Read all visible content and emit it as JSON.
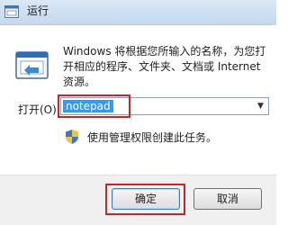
{
  "window": {
    "title": "运行",
    "icon": "run-icon"
  },
  "main": {
    "description": "Windows 将根据您所输入的名称，为您打开相应的程序、文件夹、文档或 Internet 资源。",
    "open_label": "打开(O):",
    "input_value": "notepad",
    "admin_note": "使用管理权限创建此任务。",
    "shield_icon": "uac-shield-icon"
  },
  "buttons": {
    "ok_label": "确定",
    "cancel_label": "取消"
  },
  "colors": {
    "selection": "#3399ff",
    "highlight_border": "#c8242c"
  }
}
